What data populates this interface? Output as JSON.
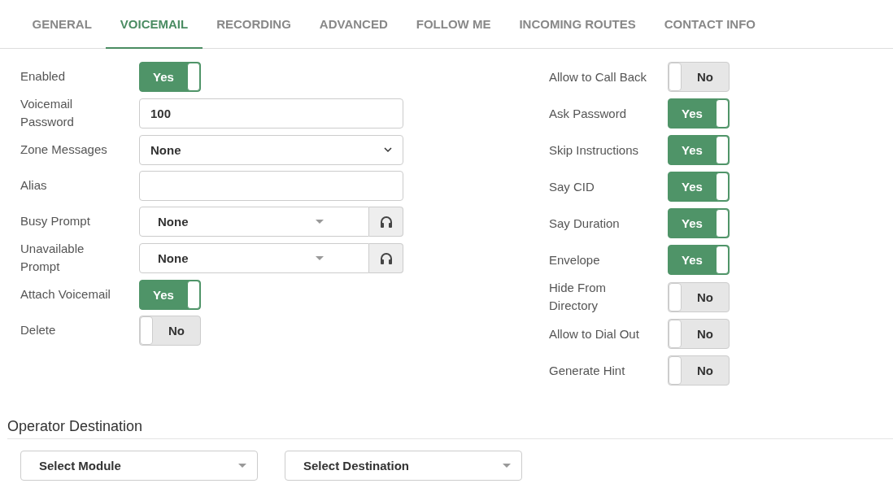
{
  "tabs": [
    {
      "label": "GENERAL",
      "selected": false
    },
    {
      "label": "VOICEMAIL",
      "selected": true
    },
    {
      "label": "RECORDING",
      "selected": false
    },
    {
      "label": "ADVANCED",
      "selected": false
    },
    {
      "label": "FOLLOW ME",
      "selected": false
    },
    {
      "label": "INCOMING ROUTES",
      "selected": false
    },
    {
      "label": "CONTACT INFO",
      "selected": false
    }
  ],
  "left_fields": [
    {
      "kind": "toggle",
      "label": "Enabled",
      "on": true,
      "text": "Yes"
    },
    {
      "kind": "text",
      "label": "Voicemail Password",
      "value": "100"
    },
    {
      "kind": "select",
      "label": "Zone Messages",
      "value": "None"
    },
    {
      "kind": "text",
      "label": "Alias"
    },
    {
      "kind": "combo",
      "label": "Busy Prompt",
      "value": "None"
    },
    {
      "kind": "combo",
      "label": "Unavailable Prompt",
      "value": "None"
    },
    {
      "kind": "toggle",
      "label": "Attach Voicemail",
      "on": true,
      "text": "Yes"
    },
    {
      "kind": "toggle",
      "label": "Delete",
      "on": false,
      "text": "No"
    }
  ],
  "right_fields": [
    {
      "kind": "toggle",
      "label": "Allow to Call Back",
      "on": false,
      "text": "No"
    },
    {
      "kind": "toggle",
      "label": "Ask Password",
      "on": true,
      "text": "Yes"
    },
    {
      "kind": "toggle",
      "label": "Skip Instructions",
      "on": true,
      "text": "Yes"
    },
    {
      "kind": "toggle",
      "label": "Say CID",
      "on": true,
      "text": "Yes"
    },
    {
      "kind": "toggle",
      "label": "Say Duration",
      "on": true,
      "text": "Yes"
    },
    {
      "kind": "toggle",
      "label": "Envelope",
      "on": true,
      "text": "Yes"
    },
    {
      "kind": "toggle",
      "label": "Hide From Directory",
      "on": false,
      "text": "No"
    },
    {
      "kind": "toggle",
      "label": "Allow to Dial Out",
      "on": false,
      "text": "No"
    },
    {
      "kind": "toggle",
      "label": "Generate Hint",
      "on": false,
      "text": "No"
    }
  ],
  "operator_destination": {
    "title": "Operator Destination",
    "selects": [
      {
        "placeholder": "Select Module"
      },
      {
        "placeholder": "Select Destination"
      }
    ]
  }
}
